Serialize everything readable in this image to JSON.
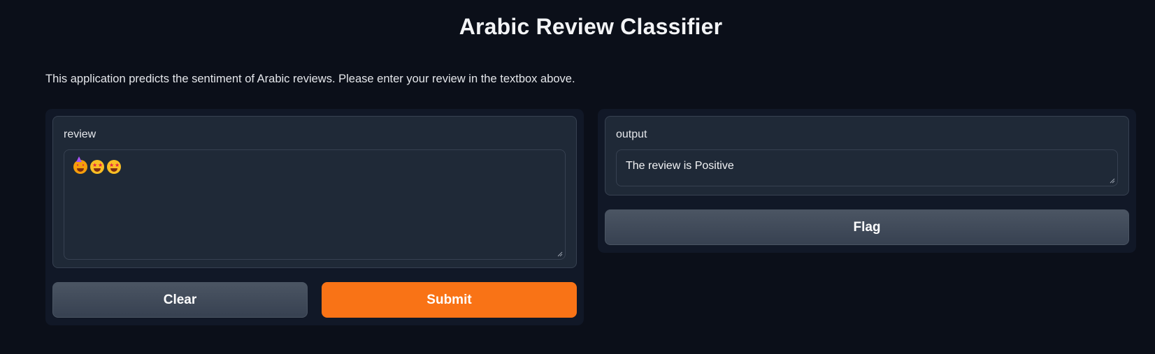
{
  "app": {
    "title": "Arabic Review Classifier",
    "description": "This application predicts the sentiment of Arabic reviews. Please enter your review in the textbox above."
  },
  "input": {
    "label": "review",
    "value_emojis": [
      "partying-face",
      "star-struck",
      "star-struck"
    ]
  },
  "output": {
    "label": "output",
    "value": "The review is Positive"
  },
  "buttons": {
    "clear": "Clear",
    "submit": "Submit",
    "flag": "Flag"
  },
  "colors": {
    "background": "#0b0f19",
    "panel": "#111827",
    "block": "#1f2937",
    "primary": "#f97316",
    "secondary": "#4b5563"
  }
}
